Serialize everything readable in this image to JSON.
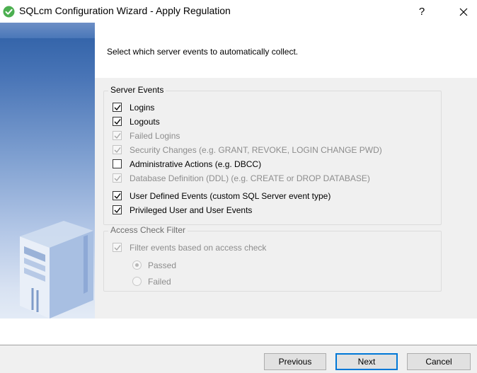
{
  "window": {
    "title": "SQLcm Configuration Wizard - Apply Regulation",
    "help_label": "?",
    "app_icon": "green-check-circle-icon",
    "close_icon": "close-icon"
  },
  "header": {
    "instruction": "Select which server events to automatically collect."
  },
  "server_events": {
    "legend": "Server Events",
    "items": [
      {
        "label": "Logins",
        "checked": true,
        "enabled": true
      },
      {
        "label": "Logouts",
        "checked": true,
        "enabled": true
      },
      {
        "label": "Failed Logins",
        "checked": true,
        "enabled": false
      },
      {
        "label": "Security Changes (e.g.  GRANT, REVOKE, LOGIN CHANGE PWD)",
        "checked": true,
        "enabled": false
      },
      {
        "label": "Administrative Actions (e.g. DBCC)",
        "checked": false,
        "enabled": true
      },
      {
        "label": "Database Definition (DDL) (e.g.  CREATE or DROP DATABASE)",
        "checked": true,
        "enabled": false
      },
      {
        "label": "User Defined Events (custom SQL Server event type)",
        "checked": true,
        "enabled": true
      },
      {
        "label": "Privileged User and User Events",
        "checked": true,
        "enabled": true
      }
    ]
  },
  "access_check": {
    "legend": "Access Check Filter",
    "filter_label": "Filter events based on access check",
    "filter_checked": true,
    "filter_enabled": false,
    "options": [
      {
        "label": "Passed",
        "selected": true
      },
      {
        "label": "Failed",
        "selected": false
      }
    ]
  },
  "footer": {
    "previous_label": "Previous",
    "next_label": "Next",
    "cancel_label": "Cancel"
  },
  "colors": {
    "accent": "#0078d7",
    "side_panel_top": "#2d5fa5",
    "side_panel_bottom": "#e3ebf6",
    "app_icon": "#4caf50"
  }
}
